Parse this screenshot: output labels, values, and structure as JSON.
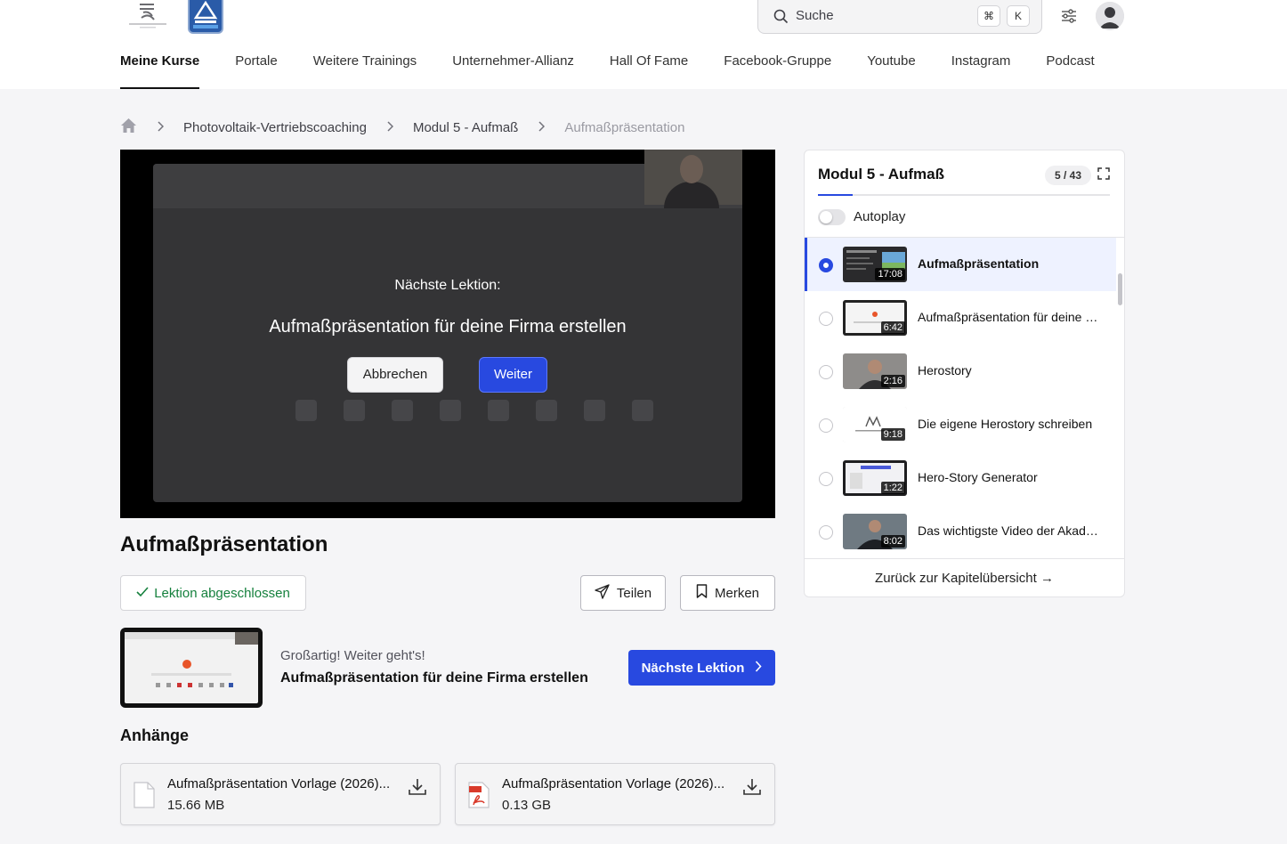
{
  "header": {
    "search_placeholder": "Suche",
    "kbd_cmd": "⌘",
    "kbd_k": "K"
  },
  "nav": {
    "items": [
      "Meine Kurse",
      "Portale",
      "Weitere Trainings",
      "Unternehmer-Allianz",
      "Hall Of Fame",
      "Facebook-Gruppe",
      "Youtube",
      "Instagram",
      "Podcast"
    ]
  },
  "breadcrumb": {
    "course": "Photovoltaik-Vertriebscoaching",
    "module": "Modul 5 - Aufmaß",
    "lesson": "Aufmaßpräsentation"
  },
  "video": {
    "next_label": "Nächste Lektion:",
    "next_title": "Aufmaßpräsentation für deine Firma erstellen",
    "cancel_label": "Abbrechen",
    "continue_label": "Weiter"
  },
  "lesson": {
    "title": "Aufmaßpräsentation",
    "completed_label": "Lektion abgeschlossen",
    "share_label": "Teilen",
    "bookmark_label": "Merken"
  },
  "next_lesson": {
    "subtitle": "Großartig! Weiter geht's!",
    "title": "Aufmaßpräsentation für deine Firma erstellen",
    "button_label": "Nächste Lektion"
  },
  "attachments": {
    "heading": "Anhänge",
    "items": [
      {
        "name": "Aufmaßpräsentation Vorlage (2026)...",
        "size": "15.66 MB"
      },
      {
        "name": "Aufmaßpräsentation Vorlage (2026)...",
        "size": "0.13 GB"
      }
    ]
  },
  "sidebar": {
    "title": "Modul 5 - Aufmaß",
    "counter": "5 / 43",
    "autoplay_label": "Autoplay",
    "lessons": [
      {
        "title": "Aufmaßpräsentation",
        "duration": "17:08"
      },
      {
        "title": "Aufmaßpräsentation für deine Firma erstellen",
        "duration": "6:42"
      },
      {
        "title": "Herostory",
        "duration": "2:16"
      },
      {
        "title": "Die eigene Herostory schreiben",
        "duration": "9:18"
      },
      {
        "title": "Hero-Story Generator",
        "duration": "1:22"
      },
      {
        "title": "Das wichtigste Video der Akademie",
        "duration": "8:02"
      }
    ],
    "back_label": "Zurück zur Kapitelübersicht →"
  },
  "colors": {
    "accent": "#2849e0",
    "success": "#15803d"
  }
}
